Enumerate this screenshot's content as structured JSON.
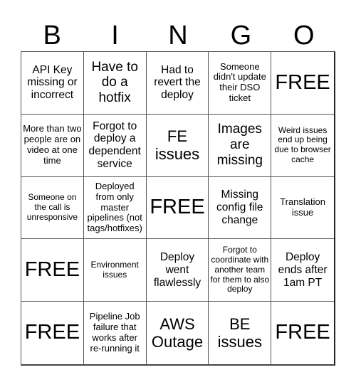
{
  "header": {
    "letters": [
      "B",
      "I",
      "N",
      "G",
      "O"
    ]
  },
  "cells": [
    {
      "text": "API Key missing or incorrect",
      "size": "md"
    },
    {
      "text": "Have to do a hotfix",
      "size": "lg"
    },
    {
      "text": "Had to revert the deploy",
      "size": "md"
    },
    {
      "text": "Someone didn't update their DSO ticket",
      "size": "sm"
    },
    {
      "text": "FREE",
      "size": "free"
    },
    {
      "text": "More than two people are on video at one time",
      "size": "sm"
    },
    {
      "text": "Forgot to deploy a dependent service",
      "size": "md"
    },
    {
      "text": "FE issues",
      "size": "xl"
    },
    {
      "text": "Images are missing",
      "size": "lg"
    },
    {
      "text": "Weird issues end up being due to browser cache",
      "size": "xs"
    },
    {
      "text": "Someone on the call is unresponsive",
      "size": "xs"
    },
    {
      "text": "Deployed from only master pipelines (not tags/hotfixes)",
      "size": "sm"
    },
    {
      "text": "FREE",
      "size": "free"
    },
    {
      "text": "Missing config file change",
      "size": "md"
    },
    {
      "text": "Translation issue",
      "size": "sm"
    },
    {
      "text": "FREE",
      "size": "free"
    },
    {
      "text": "Environment issues",
      "size": "xs"
    },
    {
      "text": "Deploy went flawlessly",
      "size": "md"
    },
    {
      "text": "Forgot to coordinate with another team for them to also deploy",
      "size": "xs"
    },
    {
      "text": "Deploy ends after 1am PT",
      "size": "md"
    },
    {
      "text": "FREE",
      "size": "free"
    },
    {
      "text": "Pipeline Job failure that works after re-running it",
      "size": "sm"
    },
    {
      "text": "AWS Outage",
      "size": "xl"
    },
    {
      "text": "BE issues",
      "size": "xl"
    },
    {
      "text": "FREE",
      "size": "free"
    }
  ]
}
